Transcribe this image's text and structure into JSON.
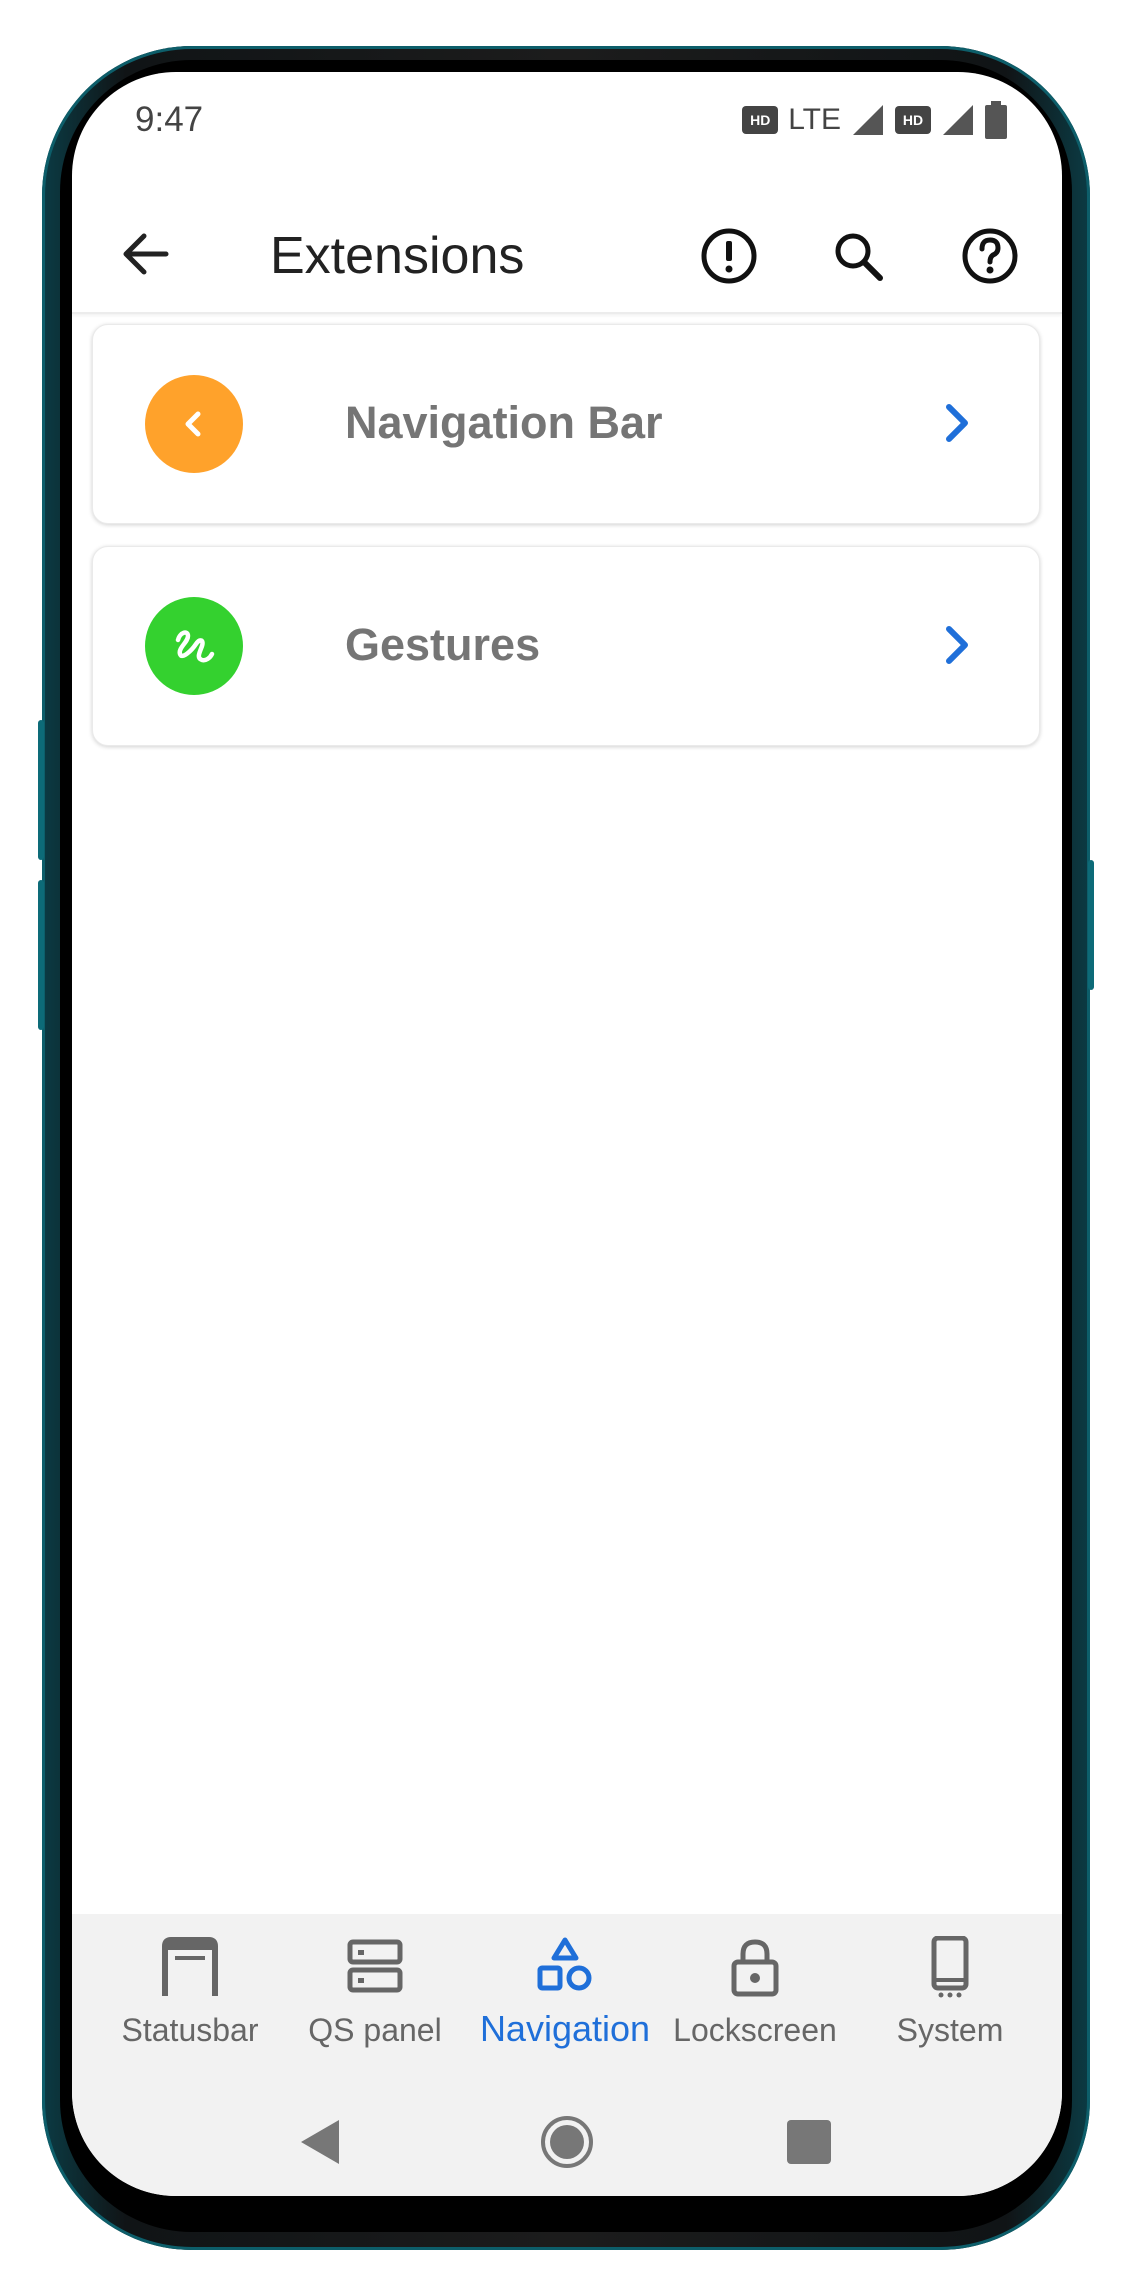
{
  "status_bar": {
    "time": "9:47",
    "hd1": "HD",
    "network": "LTE",
    "hd2": "HD"
  },
  "app_bar": {
    "title": "Extensions",
    "back_icon": "arrow-left-icon",
    "info_icon": "alert-circle-icon",
    "search_icon": "search-icon",
    "help_icon": "help-circle-icon"
  },
  "items": [
    {
      "label": "Navigation Bar",
      "icon": "chevron-left-icon",
      "icon_bg": "#FFA22B"
    },
    {
      "label": "Gestures",
      "icon": "gesture-icon",
      "icon_bg": "#34D12F"
    }
  ],
  "bottom_nav": {
    "active_color": "#1f6fd9",
    "items": [
      {
        "label": "Statusbar",
        "icon": "statusbar-icon"
      },
      {
        "label": "QS panel",
        "icon": "qs-panel-icon"
      },
      {
        "label": "Navigation",
        "icon": "shapes-icon",
        "active": true
      },
      {
        "label": "Lockscreen",
        "icon": "lock-icon"
      },
      {
        "label": "System",
        "icon": "phone-icon"
      }
    ]
  },
  "system_nav": [
    "back-triangle-icon",
    "home-circle-icon",
    "recents-square-icon"
  ]
}
